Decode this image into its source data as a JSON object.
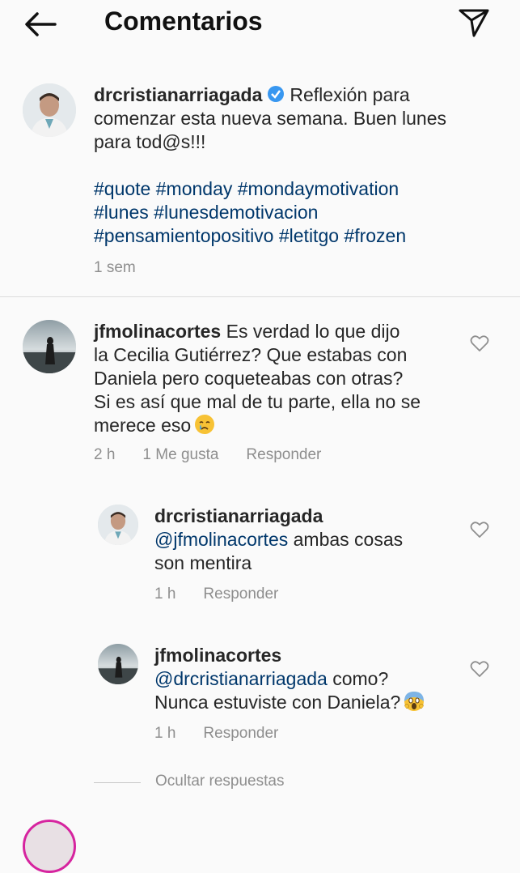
{
  "header": {
    "title": "Comentarios",
    "back_icon": "arrow-left-icon",
    "send_icon": "paper-plane-icon"
  },
  "caption": {
    "username": "drcristianarriagada",
    "verified": true,
    "text_line1": "Reflexión para",
    "text_line2": "comenzar esta nueva semana. Buen lunes",
    "text_line3": "para tod@s!!!",
    "hashtags_line1": "#quote #monday #mondaymotivation",
    "hashtags_line2": "#lunes #lunesdemotivacion",
    "hashtags_line3": "#pensamientopositivo #letitgo #frozen",
    "time": "1 sem"
  },
  "comments": [
    {
      "username": "jfmolinacortes",
      "line1": "Es verdad lo que dijo",
      "line2": "la Cecilia Gutiérrez? Que estabas con",
      "line3": "Daniela pero coqueteabas con otras?",
      "line4": "Si es así que mal de tu parte, ella no se",
      "line5": "merece eso",
      "emoji": "crying-face",
      "time": "2 h",
      "likes": "1 Me gusta",
      "reply": "Responder"
    }
  ],
  "replies": [
    {
      "username": "drcristianarriagada",
      "mention": "@jfmolinacortes",
      "text1": " ambas cosas",
      "text2": "son mentira",
      "time": "1 h",
      "reply": "Responder"
    },
    {
      "username": "jfmolinacortes",
      "mention": "@drcristianarriagada",
      "text1": " como?",
      "text2": "Nunca estuviste con Daniela?",
      "emoji": "screaming-face",
      "time": "1 h",
      "reply": "Responder"
    }
  ],
  "hide_replies": "Ocultar respuestas",
  "colors": {
    "link": "#00376b",
    "meta": "#8e8e8e",
    "verified": "#3897f0"
  }
}
